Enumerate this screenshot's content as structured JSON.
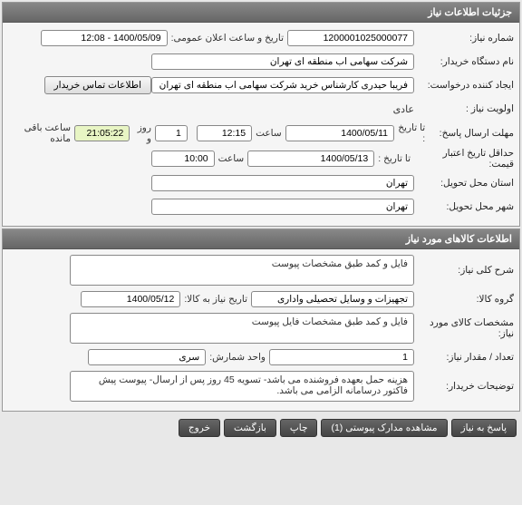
{
  "panels": {
    "need_info": "جزئیات اطلاعات نیاز",
    "goods_info": "اطلاعات کالاهای مورد نیاز"
  },
  "labels": {
    "need_number": "شماره نیاز:",
    "announce_date": "تاریخ و ساعت اعلان عمومی:",
    "buyer_name": "نام دستگاه خریدار:",
    "requester": "ایجاد کننده درخواست:",
    "buyer_contact_btn": "اطلاعات تماس خریدار",
    "priority": "اولویت نیاز :",
    "response_deadline": "مهلت ارسال پاسخ:",
    "to_date": "تا تاریخ :",
    "time": "ساعت",
    "days_and": "روز و",
    "hours_left": "ساعت باقی مانده",
    "price_validity": "حداقل تاریخ اعتبار قیمت:",
    "delivery_province": "استان محل تحویل:",
    "delivery_city": "شهر محل تحویل:",
    "general_desc": "شرح کلی نیاز:",
    "goods_group": "گروه کالا:",
    "need_date": "تاریح نیاز به کالا:",
    "goods_spec": "مشخصات کالای مورد نياز:",
    "qty": "تعداد / مقدار نیاز:",
    "unit": "واحد شمارش:",
    "buyer_notes": "توضیحات خریدار:"
  },
  "values": {
    "need_number": "1200001025000077",
    "announce_date": "1400/05/09 - 12:08",
    "buyer_name": "شرکت سهامی اب منطقه ای تهران",
    "requester": "فریبا حیدری کارشناس خرید شرکت سهامی اب منطقه ای تهران",
    "priority": "عادی",
    "resp_date": "1400/05/11",
    "resp_time": "12:15",
    "days_left": "1",
    "hours_left": "21:05:22",
    "valid_date": "1400/05/13",
    "valid_time": "10:00",
    "province": "تهران",
    "city": "تهران",
    "general_desc": "فایل و کمد طبق مشخصات پیوست",
    "goods_group": "تجهیزات و وسایل تحصیلی واداری",
    "need_date": "1400/05/12",
    "goods_spec": "فایل و كمد طبق مشخصات فایل پیوست",
    "qty": "1",
    "unit": "سری",
    "buyer_notes": "هزینه حمل بعهده فروشنده می باشد- تسویه 45 روز پس از ارسال- پیوست پیش فاکتور درسامانه الزامی می باشد."
  },
  "buttons": {
    "respond": "پاسخ به نیاز",
    "attachments": "مشاهده مدارک پیوستی (1)",
    "print": "چاپ",
    "back": "بازگشت",
    "exit": "خروج"
  }
}
